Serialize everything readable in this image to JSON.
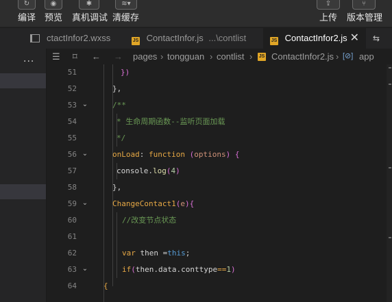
{
  "toolbar": {
    "items": [
      {
        "label": "编译",
        "icon": "refresh-icon"
      },
      {
        "label": "预览",
        "icon": "eye-icon"
      },
      {
        "label": "真机调试",
        "icon": "bug-icon"
      },
      {
        "label": "清缓存",
        "icon": "layers-icon"
      },
      {
        "label": "上传",
        "icon": "upload-icon"
      },
      {
        "label": "版本管理",
        "icon": "branch-icon"
      }
    ]
  },
  "tabs": [
    {
      "name": "ctactInfor2.wxss",
      "active": false
    },
    {
      "name": "ContactInfor.js",
      "sub": "...\\contlist",
      "active": false
    },
    {
      "name": "ContactInfor2.js",
      "active": true
    }
  ],
  "sidebar": {
    "more": "..."
  },
  "breadcrumb": [
    "pages",
    "tongguan",
    "contlist",
    "ContactInfor2.js",
    "app"
  ],
  "code_lines": [
    {
      "n": "51",
      "fold": false
    },
    {
      "n": "52",
      "fold": false
    },
    {
      "n": "53",
      "fold": true
    },
    {
      "n": "54",
      "fold": false
    },
    {
      "n": "55",
      "fold": false
    },
    {
      "n": "56",
      "fold": true
    },
    {
      "n": "57",
      "fold": false
    },
    {
      "n": "58",
      "fold": false
    },
    {
      "n": "59",
      "fold": true
    },
    {
      "n": "60",
      "fold": false
    },
    {
      "n": "61",
      "fold": false
    },
    {
      "n": "62",
      "fold": false
    },
    {
      "n": "63",
      "fold": true
    },
    {
      "n": "64",
      "fold": false
    }
  ],
  "code": {
    "l51": "})",
    "l52": "},",
    "l53": "/**",
    "l54": "* 生命周期函数--监听页面加载",
    "l55": "*/",
    "l56_key": "onLoad",
    "l56_colon": ": ",
    "l56_fn": "function",
    "l56_open": " (",
    "l56_param": "options",
    "l56_close": ") {",
    "l57_obj": "console.",
    "l57_fn": "log",
    "l57_open": "(",
    "l57_num": "4",
    "l57_close": ")",
    "l58": "},",
    "l59_key": "ChangeContact1",
    "l59_open": "(",
    "l59_param": "e",
    "l59_close": "){",
    "l60": "//改变节点状态",
    "l62_kw": "var",
    "l62_mid": " then =",
    "l62_this": "this",
    "l62_end": ";",
    "l63_kw": "if",
    "l63_open": "(",
    "l63_expr": "then.data.conttype",
    "l63_op": "==",
    "l63_num": "1",
    "l63_close": ")",
    "l64": "{"
  }
}
